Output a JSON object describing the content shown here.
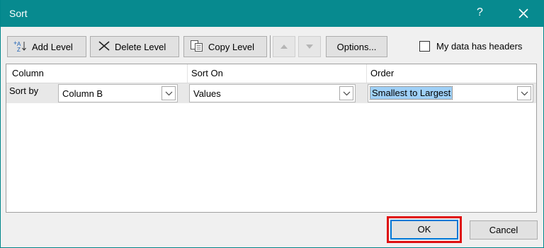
{
  "dialog": {
    "title": "Sort",
    "help_glyph": "?",
    "close_glyph": "✕"
  },
  "toolbar": {
    "add_level": "Add Level",
    "delete_level": "Delete Level",
    "copy_level": "Copy Level",
    "options": "Options...",
    "move_up_icon": "triangle-up-icon",
    "move_down_icon": "triangle-down-icon"
  },
  "headers_checkbox": {
    "label": "My data has headers",
    "checked": false
  },
  "grid": {
    "columns": [
      "Column",
      "Sort On",
      "Order"
    ],
    "rows": [
      {
        "label": "Sort by",
        "column": "Column B",
        "sort_on": "Values",
        "order": "Smallest to Largest"
      }
    ]
  },
  "footer": {
    "ok": "OK",
    "cancel": "Cancel"
  },
  "colors": {
    "title_bar": "#078a8f",
    "highlight": "#e01010",
    "selection": "#9fd0f7"
  }
}
